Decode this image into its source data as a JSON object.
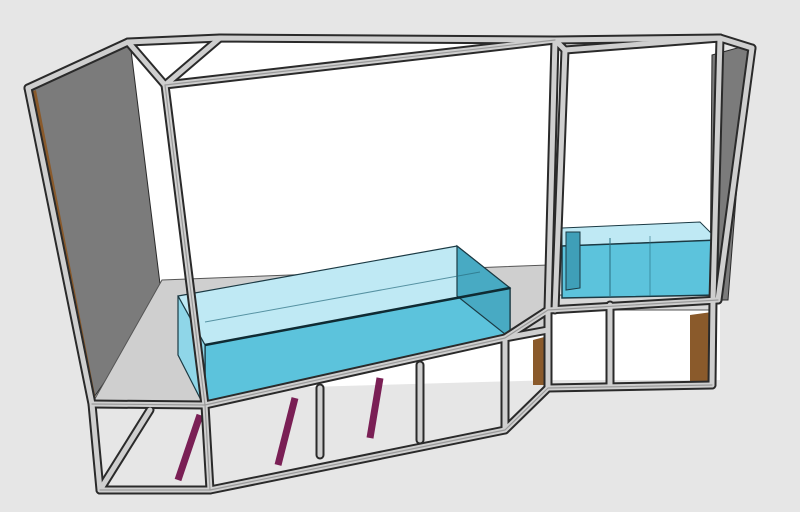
{
  "scene": {
    "description_hidden": "",
    "colors": {
      "background": "#e6e6e6",
      "frame_outer": "#8f8f8f",
      "frame_inner": "#cfcfcf",
      "frame_edge": "#2a2a2a",
      "side_panel": "#7d7d7d",
      "back_wall": "#ffffff",
      "floor_panel": "#cfcfcf",
      "water_top": "#bfe9f4",
      "water_front": "#5cc3dc",
      "water_side": "#47a9c2",
      "glass_edge": "#1b3a44",
      "support_purple": "#7a1f55",
      "wood_edge": "#8a5a2b"
    }
  }
}
